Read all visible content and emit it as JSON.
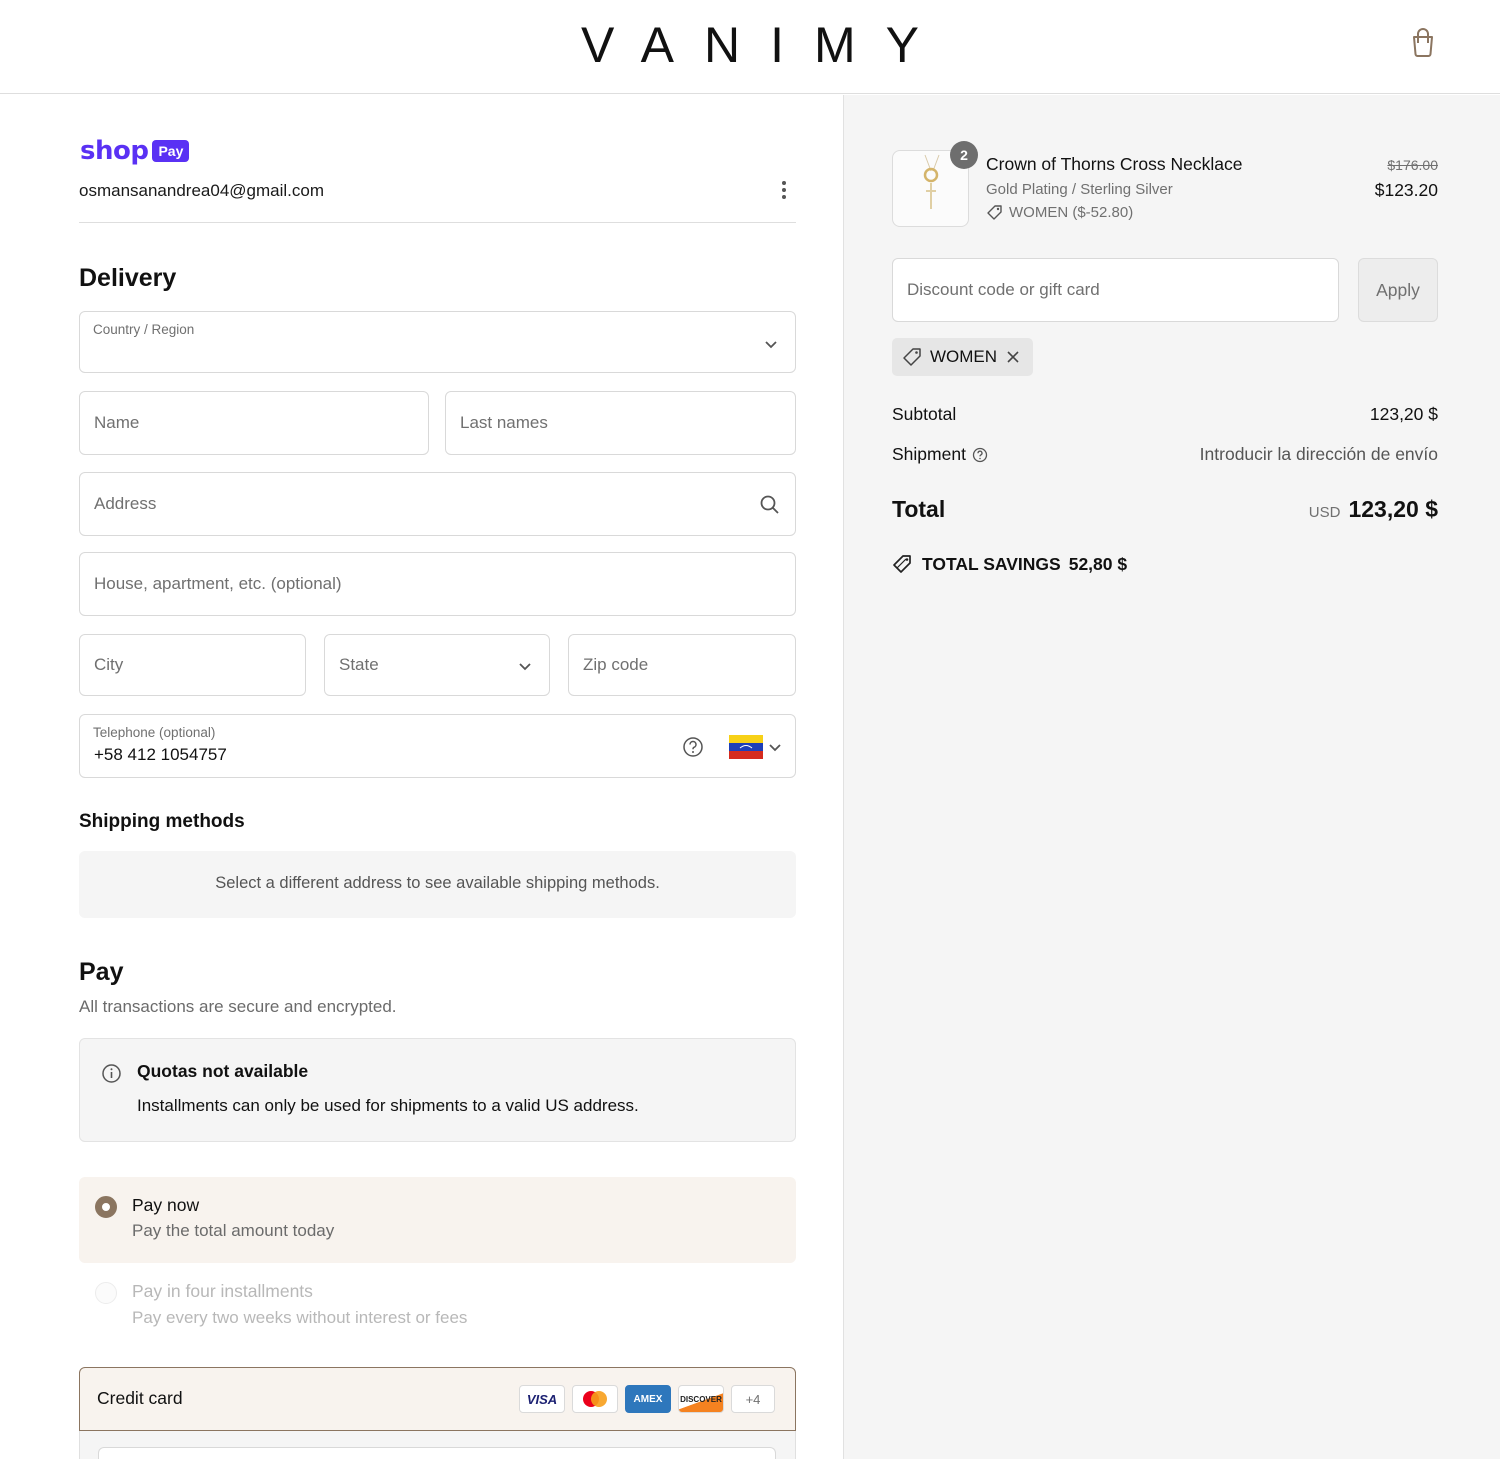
{
  "header": {
    "brand": "VANIMY",
    "cart_icon": "shopping-bag-icon"
  },
  "account": {
    "shop_word": "shop",
    "shop_badge": "Pay",
    "email": "osmansanandrea04@gmail.com",
    "menu_icon": "kebab-menu-icon"
  },
  "delivery": {
    "title": "Delivery",
    "country_label": "Country / Region",
    "name_placeholder": "Name",
    "last_names_placeholder": "Last names",
    "address_placeholder": "Address",
    "house_placeholder": "House, apartment, etc. (optional)",
    "city_placeholder": "City",
    "state_placeholder": "State",
    "zip_placeholder": "Zip code",
    "telephone_label": "Telephone (optional)",
    "telephone_value": "+58 412 1054757"
  },
  "shipping": {
    "title": "Shipping methods",
    "notice": "Select a different address to see available shipping methods."
  },
  "pay": {
    "title": "Pay",
    "subtitle": "All transactions are secure and encrypted.",
    "quota_title": "Quotas not available",
    "quota_desc": "Installments can only be used for shipments to a valid US address.",
    "options": [
      {
        "title": "Pay now",
        "desc": "Pay the total amount today",
        "selected": true
      },
      {
        "title": "Pay in four installments",
        "desc": "Pay every two weeks without interest or fees",
        "selected": false
      }
    ],
    "credit_card_label": "Credit card",
    "card_brands": [
      "VISA",
      "mastercard",
      "AMEX",
      "DISCOVER",
      "+4"
    ]
  },
  "summary": {
    "product": {
      "quantity": "2",
      "name": "Crown of Thorns Cross Necklace",
      "variant": "Gold Plating / Sterling Silver",
      "discount": "WOMEN ($-52.80)",
      "price_old": "$176.00",
      "price_new": "$123.20"
    },
    "discount_placeholder": "Discount code or gift card",
    "apply_label": "Apply",
    "applied_code": "WOMEN",
    "subtotal_label": "Subtotal",
    "subtotal_value": "123,20 $",
    "shipment_label": "Shipment",
    "shipment_value": "Introducir la dirección de envío",
    "total_label": "Total",
    "total_currency": "USD",
    "total_value": "123,20 $",
    "savings_label": "TOTAL SAVINGS",
    "savings_value": "52,80 $"
  },
  "colors": {
    "shop_purple": "#5a31f4",
    "accent_brown": "#8b7560",
    "option_bg": "#f8f3ee"
  }
}
